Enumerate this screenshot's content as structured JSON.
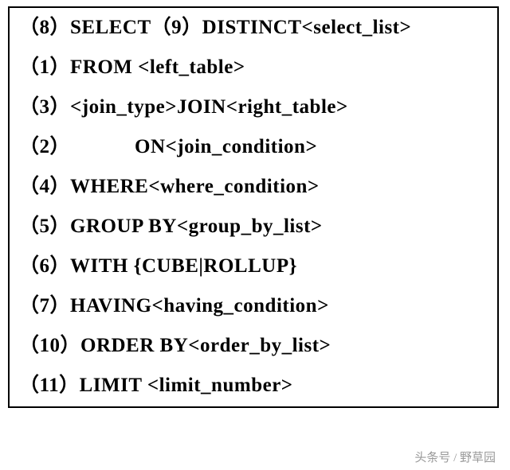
{
  "lines": [
    "（8）SELECT（9）DISTINCT<select_list>",
    "（1）FROM <left_table>",
    "（3）<join_type>JOIN<right_table>",
    "（2）            ON<join_condition>",
    "（4）WHERE<where_condition>",
    "（5）GROUP BY<group_by_list>",
    "（6）WITH {CUBE|ROLLUP}",
    "（7）HAVING<having_condition>",
    "（10）ORDER BY<order_by_list>",
    "（11）LIMIT <limit_number>"
  ],
  "footer": "头条号 / 野草园"
}
